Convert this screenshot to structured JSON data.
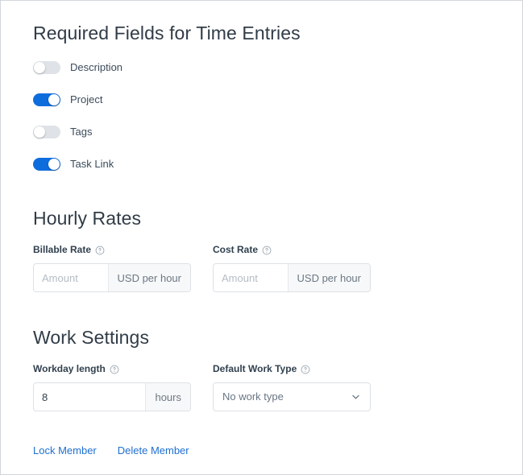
{
  "required_fields": {
    "heading": "Required Fields for Time Entries",
    "toggles": [
      {
        "label": "Description",
        "on": false
      },
      {
        "label": "Project",
        "on": true
      },
      {
        "label": "Tags",
        "on": false
      },
      {
        "label": "Task Link",
        "on": true
      }
    ]
  },
  "hourly_rates": {
    "heading": "Hourly Rates",
    "billable": {
      "label": "Billable Rate",
      "help_icon": "help-circle-icon",
      "value": "",
      "placeholder": "Amount",
      "addon": "USD per hour"
    },
    "cost": {
      "label": "Cost Rate",
      "help_icon": "help-circle-icon",
      "value": "",
      "placeholder": "Amount",
      "addon": "USD per hour"
    }
  },
  "work_settings": {
    "heading": "Work Settings",
    "workday_length": {
      "label": "Workday length",
      "help_icon": "help-circle-icon",
      "value": "8",
      "placeholder": "",
      "addon": "hours"
    },
    "default_work_type": {
      "label": "Default Work Type",
      "help_icon": "help-circle-icon",
      "selected": "No work type",
      "caret_icon": "chevron-down-icon"
    }
  },
  "footer_actions": {
    "lock_member": "Lock Member",
    "delete_member": "Delete Member"
  },
  "colors": {
    "toggle_on": "#0e6ddd",
    "toggle_off": "#dfe3e7",
    "link": "#1f6fd0",
    "heading": "#313c47",
    "border": "#dde1e5"
  }
}
